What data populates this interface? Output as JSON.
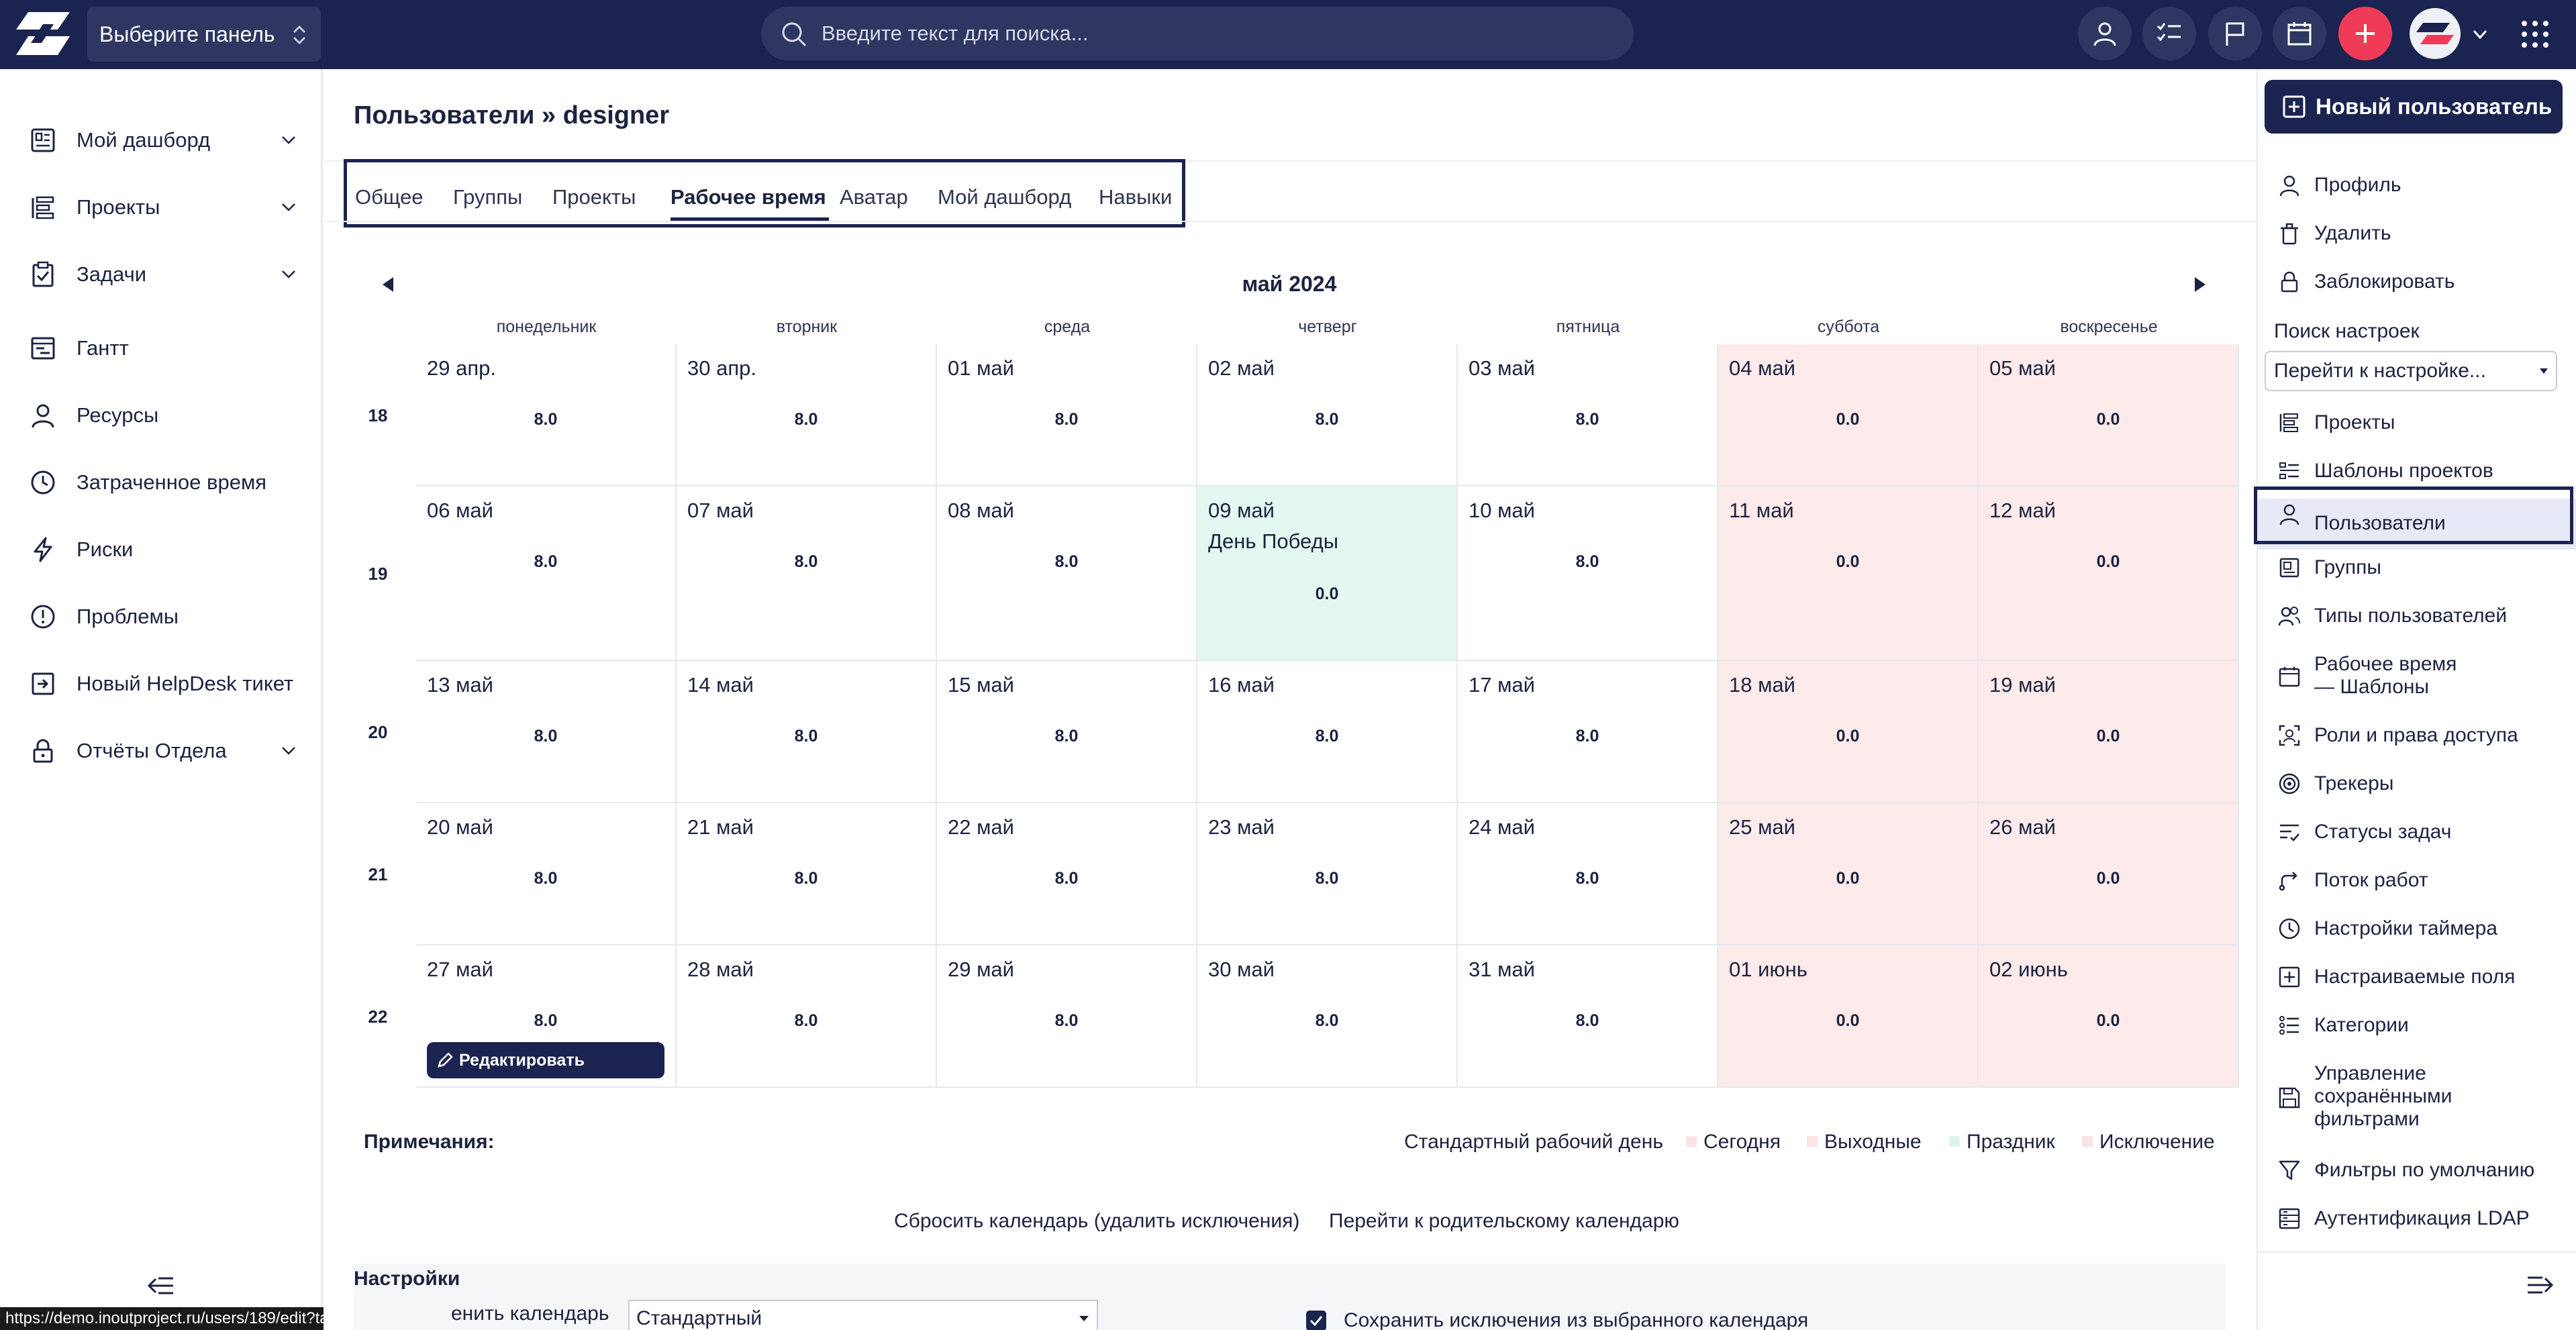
{
  "topbar": {
    "panel_select": "Выберите панель",
    "search_placeholder": "Введите текст для поиска..."
  },
  "sidebar": {
    "items": [
      {
        "label": "Мой дашборд",
        "icon": "dashboard-icon",
        "expandable": true
      },
      {
        "label": "Проекты",
        "icon": "projects-icon",
        "expandable": true
      },
      {
        "label": "Задачи",
        "icon": "tasks-icon",
        "expandable": true
      },
      {
        "label": "Гантт",
        "icon": "gantt-icon",
        "expandable": false
      },
      {
        "label": "Ресурсы",
        "icon": "user-icon",
        "expandable": false
      },
      {
        "label": "Затраченное время",
        "icon": "clock-icon",
        "expandable": false
      },
      {
        "label": "Риски",
        "icon": "lightning-icon",
        "expandable": false
      },
      {
        "label": "Проблемы",
        "icon": "alert-icon",
        "expandable": false
      },
      {
        "label": "Новый HelpDesk тикет",
        "icon": "login-icon",
        "expandable": false
      },
      {
        "label": "Отчёты Отдела",
        "icon": "lock-icon",
        "expandable": true
      }
    ]
  },
  "status_url": "https://demo.inoutproject.ru/users/189/edit?tab=working_time",
  "page": {
    "title": "Пользователи » designer",
    "tabs": [
      "Общее",
      "Группы",
      "Проекты",
      "Рабочее время",
      "Аватар",
      "Мой дашборд",
      "Навыки"
    ],
    "active_tab": "Рабочее время"
  },
  "calendar": {
    "month": "май 2024",
    "weekdays": [
      "понедельник",
      "вторник",
      "среда",
      "четверг",
      "пятница",
      "суббота",
      "воскресенье"
    ],
    "weeks": [
      {
        "num": "18",
        "days": [
          {
            "date": "29 апр.",
            "hours": "8.0"
          },
          {
            "date": "30 апр.",
            "hours": "8.0"
          },
          {
            "date": "01 май",
            "hours": "8.0"
          },
          {
            "date": "02 май",
            "hours": "8.0"
          },
          {
            "date": "03 май",
            "hours": "8.0"
          },
          {
            "date": "04 май",
            "hours": "0.0",
            "type": "weekend"
          },
          {
            "date": "05 май",
            "hours": "0.0",
            "type": "weekend"
          }
        ]
      },
      {
        "num": "19",
        "days": [
          {
            "date": "06 май",
            "hours": "8.0"
          },
          {
            "date": "07 май",
            "hours": "8.0"
          },
          {
            "date": "08 май",
            "hours": "8.0"
          },
          {
            "date": "09 май",
            "hours": "0.0",
            "type": "holiday",
            "holiday": "День Победы"
          },
          {
            "date": "10 май",
            "hours": "8.0"
          },
          {
            "date": "11 май",
            "hours": "0.0",
            "type": "weekend"
          },
          {
            "date": "12 май",
            "hours": "0.0",
            "type": "weekend"
          }
        ]
      },
      {
        "num": "20",
        "days": [
          {
            "date": "13 май",
            "hours": "8.0"
          },
          {
            "date": "14 май",
            "hours": "8.0"
          },
          {
            "date": "15 май",
            "hours": "8.0"
          },
          {
            "date": "16 май",
            "hours": "8.0"
          },
          {
            "date": "17 май",
            "hours": "8.0"
          },
          {
            "date": "18 май",
            "hours": "0.0",
            "type": "weekend"
          },
          {
            "date": "19 май",
            "hours": "0.0",
            "type": "weekend"
          }
        ]
      },
      {
        "num": "21",
        "days": [
          {
            "date": "20 май",
            "hours": "8.0"
          },
          {
            "date": "21 май",
            "hours": "8.0"
          },
          {
            "date": "22 май",
            "hours": "8.0"
          },
          {
            "date": "23 май",
            "hours": "8.0"
          },
          {
            "date": "24 май",
            "hours": "8.0"
          },
          {
            "date": "25 май",
            "hours": "0.0",
            "type": "weekend"
          },
          {
            "date": "26 май",
            "hours": "0.0",
            "type": "weekend"
          }
        ]
      },
      {
        "num": "22",
        "days": [
          {
            "date": "27 май",
            "hours": "8.0",
            "edit": "Редактировать"
          },
          {
            "date": "28 май",
            "hours": "8.0"
          },
          {
            "date": "29 май",
            "hours": "8.0"
          },
          {
            "date": "30 май",
            "hours": "8.0"
          },
          {
            "date": "31 май",
            "hours": "8.0"
          },
          {
            "date": "01 июнь",
            "hours": "0.0",
            "type": "weekend"
          },
          {
            "date": "02 июнь",
            "hours": "0.0",
            "type": "weekend"
          }
        ]
      }
    ]
  },
  "notes": {
    "label": "Примечания:",
    "standard_day": "Стандартный рабочий день",
    "legend": [
      {
        "label": "Сегодня",
        "color": "#fde3e3"
      },
      {
        "label": "Выходные",
        "color": "#fde3e3"
      },
      {
        "label": "Праздник",
        "color": "#ddf6ec"
      },
      {
        "label": "Исключение",
        "color": "#fde3e3"
      }
    ]
  },
  "actions": {
    "reset": "Сбросить календарь (удалить исключения)",
    "parent": "Перейти к родительскому календарю"
  },
  "settings": {
    "title": "Настройки",
    "label": "енить календарь",
    "select_value": "Стандартный",
    "checkbox_label": "Сохранить исключения из выбранного календаря"
  },
  "right_panel": {
    "new_user": "Новый пользователь",
    "top_items": [
      {
        "label": "Профиль",
        "icon": "user-icon"
      },
      {
        "label": "Удалить",
        "icon": "trash-icon"
      },
      {
        "label": "Заблокировать",
        "icon": "lock-icon"
      }
    ],
    "search_label": "Поиск настроек",
    "search_select": "Перейти к настройке...",
    "items": [
      {
        "label": "Проекты",
        "icon": "projects-icon"
      },
      {
        "label": "Шаблоны проектов",
        "icon": "list-icon"
      },
      {
        "label": "Пользователи",
        "icon": "user-icon",
        "active": true
      },
      {
        "label": "Группы",
        "icon": "group-icon"
      },
      {
        "label": "Типы пользователей",
        "icon": "users-icon"
      },
      {
        "label": "Рабочее время\n— Шаблоны",
        "icon": "calendar-icon"
      },
      {
        "label": "Роли и права доступа",
        "icon": "roles-icon"
      },
      {
        "label": "Трекеры",
        "icon": "target-icon"
      },
      {
        "label": "Статусы задач",
        "icon": "status-icon"
      },
      {
        "label": "Поток работ",
        "icon": "workflow-icon"
      },
      {
        "label": "Настройки таймера",
        "icon": "clock-icon"
      },
      {
        "label": "Настраиваемые поля",
        "icon": "plus-square-icon"
      },
      {
        "label": "Категории",
        "icon": "categories-icon"
      },
      {
        "label": "Управление\nсохранёнными\nфильтрами",
        "icon": "save-icon"
      },
      {
        "label": "Фильтры по умолчанию",
        "icon": "filter-icon"
      },
      {
        "label": "Аутентификация LDAP",
        "icon": "ldap-icon"
      }
    ]
  }
}
